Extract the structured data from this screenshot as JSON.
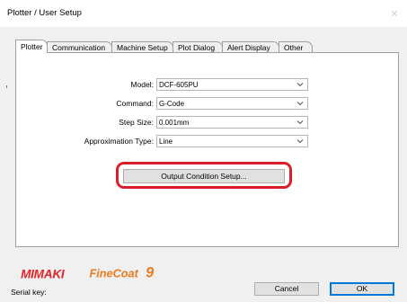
{
  "window": {
    "title": "Plotter / User Setup",
    "close_glyph": "✕"
  },
  "tabs": [
    {
      "label": "Plotter",
      "active": true
    },
    {
      "label": "Communication",
      "active": false
    },
    {
      "label": "Machine Setup",
      "active": false
    },
    {
      "label": "Plot Dialog",
      "active": false
    },
    {
      "label": "Alert Display",
      "active": false
    },
    {
      "label": "Other",
      "active": false
    }
  ],
  "form": {
    "model": {
      "label": "Model:",
      "value": "DCF-605PU"
    },
    "command": {
      "label": "Command:",
      "value": "G-Code"
    },
    "step_size": {
      "label": "Step Size:",
      "value": "0.001mm"
    },
    "approximation": {
      "label": "Approximation Type:",
      "value": "Line"
    }
  },
  "output_condition_button": "Output Condition Setup...",
  "footer": {
    "logo_brand": "MIMAKI",
    "logo_product": "FineCoat9",
    "serial_label": "Serial key:",
    "cancel_label": "Cancel",
    "ok_label": "OK"
  },
  "colors": {
    "logo_red": "#e1252b",
    "logo_orange": "#ee7a1f",
    "highlight_red": "#d9202a",
    "focus_blue": "#0078d7"
  },
  "icons": {
    "dropdown": "chevron-down-icon",
    "close": "close-icon"
  }
}
